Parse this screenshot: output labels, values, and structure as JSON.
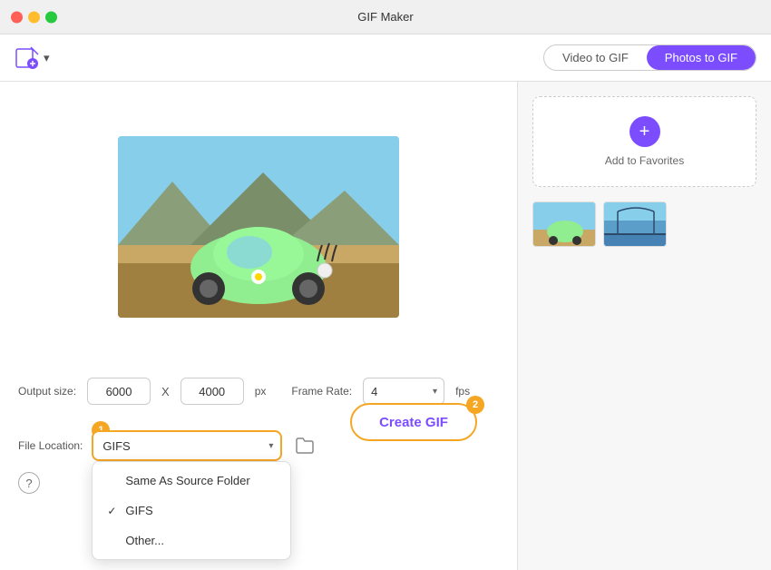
{
  "app": {
    "title": "GIF Maker"
  },
  "toolbar": {
    "import_label": "▾",
    "tab_video": "Video to GIF",
    "tab_photos": "Photos to GIF"
  },
  "settings": {
    "output_size_label": "Output size:",
    "width_value": "6000",
    "height_value": "4000",
    "x_separator": "X",
    "px_label": "px",
    "frame_rate_label": "Frame Rate:",
    "frame_rate_value": "4",
    "fps_label": "fps"
  },
  "file_location": {
    "label": "File Location:",
    "selected": "GIFS",
    "folder_icon": "📁"
  },
  "dropdown": {
    "items": [
      {
        "label": "Same As Source Folder",
        "checked": false
      },
      {
        "label": "GIFS",
        "checked": true
      },
      {
        "label": "Other...",
        "checked": false
      }
    ]
  },
  "favorites": {
    "add_label": "Add to Favorites"
  },
  "create_gif": {
    "button_label": "Create GIF"
  },
  "badges": {
    "badge1": "1",
    "badge2": "2"
  },
  "help": {
    "icon": "?"
  }
}
